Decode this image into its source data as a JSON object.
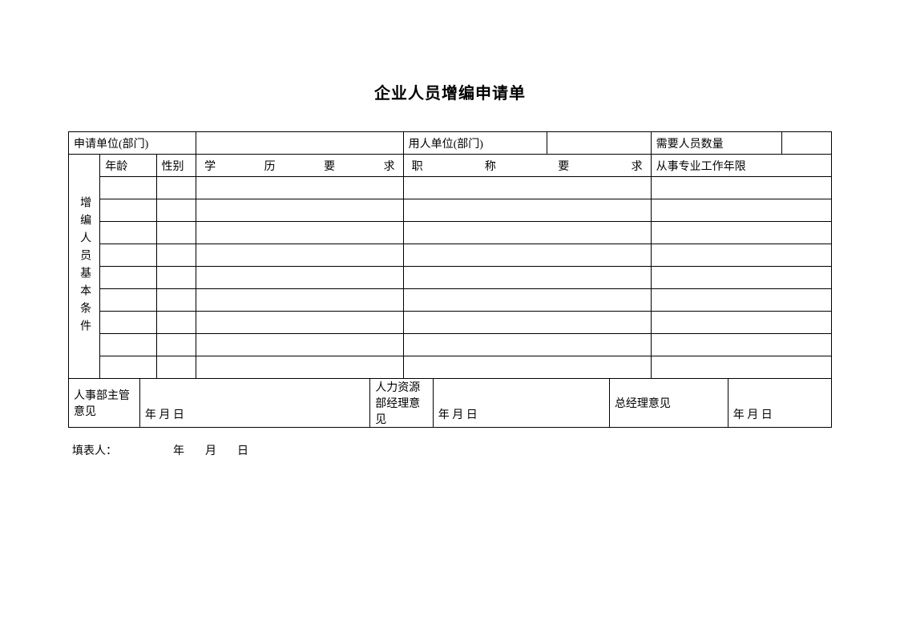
{
  "title": "企业人员增编申请单",
  "row1": {
    "apply_unit_label": "申请单位(部门)",
    "apply_unit_value": "",
    "use_unit_label": "用人单位(部门)",
    "use_unit_value": "",
    "qty_label": "需要人员数量",
    "qty_value": ""
  },
  "row2": {
    "side_label": "增编人员基本条件",
    "age_label": "年龄",
    "gender_label": "性别",
    "edu_label": "学历要求",
    "title_label": "职称要求",
    "years_label": "从事专业工作年限"
  },
  "data_rows": [
    {
      "age": "",
      "gender": "",
      "edu": "",
      "title": "",
      "years": ""
    },
    {
      "age": "",
      "gender": "",
      "edu": "",
      "title": "",
      "years": ""
    },
    {
      "age": "",
      "gender": "",
      "edu": "",
      "title": "",
      "years": ""
    },
    {
      "age": "",
      "gender": "",
      "edu": "",
      "title": "",
      "years": ""
    },
    {
      "age": "",
      "gender": "",
      "edu": "",
      "title": "",
      "years": ""
    },
    {
      "age": "",
      "gender": "",
      "edu": "",
      "title": "",
      "years": ""
    },
    {
      "age": "",
      "gender": "",
      "edu": "",
      "title": "",
      "years": ""
    },
    {
      "age": "",
      "gender": "",
      "edu": "",
      "title": "",
      "years": ""
    },
    {
      "age": "",
      "gender": "",
      "edu": "",
      "title": "",
      "years": ""
    }
  ],
  "sig": {
    "hr_super_label": "人事部主管意见",
    "hr_super_date": "年 月 日",
    "hr_mgr_label": "人力资源部经理意见",
    "hr_mgr_date": "年 月 日",
    "gm_label": "总经理意见",
    "gm_date": "年 月 日"
  },
  "footer": {
    "filler_label": "填表人：",
    "date": "年　月　日"
  }
}
